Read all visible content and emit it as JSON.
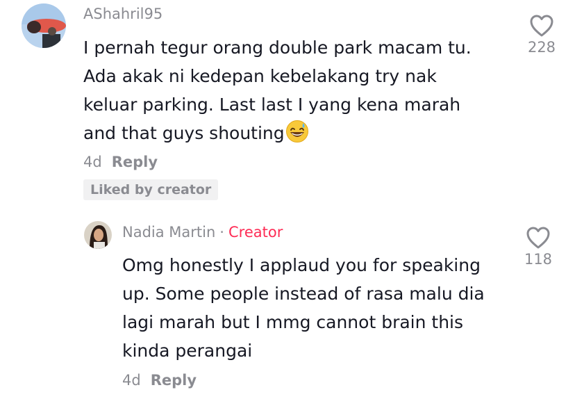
{
  "comments": [
    {
      "username": "AShahril95",
      "lines": [
        "I pernah tegur orang double park macam tu.",
        "Ada akak ni kedepan kebelakang try nak",
        "keluar parking. Last last I yang kena marah",
        "and that guys shouting"
      ],
      "time": "4d",
      "reply_label": "Reply",
      "badge": "Liked by creator",
      "likes": "228",
      "emoji": "grinning-sweat-emoji"
    },
    {
      "username": "Nadia Martin",
      "separator": "·",
      "role": "Creator",
      "lines": [
        "Omg honestly I applaud you for speaking",
        "up. Some people instead of rasa malu dia",
        "lagi marah but I mmg cannot brain this",
        "kinda perangai"
      ],
      "time": "4d",
      "reply_label": "Reply",
      "likes": "118"
    }
  ],
  "colors": {
    "text": "#161823",
    "muted": "#8a8b91",
    "creator": "#fe2c55",
    "badge_bg": "#f1f1f2"
  },
  "icons": {
    "like": "heart-outline-icon"
  }
}
